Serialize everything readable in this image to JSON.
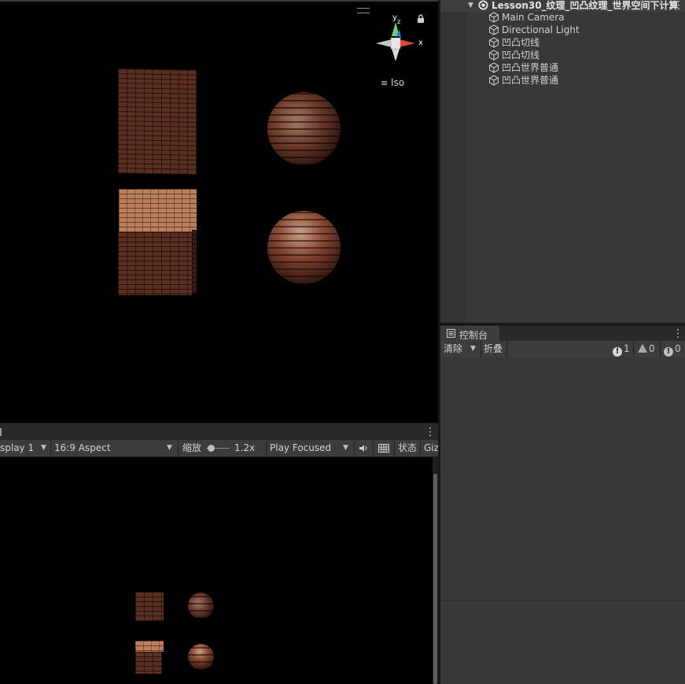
{
  "scene": {
    "iso_label": "Iso",
    "gizmo": {
      "y_label": "y",
      "z_label": "z",
      "x_label": "x"
    }
  },
  "game_view": {
    "tab_label": "",
    "display": "splay 1",
    "aspect": "16:9 Aspect",
    "scale_label": "缩放",
    "scale_value": "1.2x",
    "play_mode": "Play Focused",
    "stats_label": "状态",
    "gizmos_label": "Giz"
  },
  "hierarchy": {
    "scene_name": "Lesson30_纹理_凹凸纹理_世界空间下计算",
    "items": [
      {
        "label": "Main Camera"
      },
      {
        "label": "Directional Light"
      },
      {
        "label": "凹凸切线"
      },
      {
        "label": "凹凸切线"
      },
      {
        "label": "凹凸世界普通"
      },
      {
        "label": "凹凸世界普通"
      }
    ]
  },
  "console": {
    "tab_label": "控制台",
    "clear_label": "清除",
    "collapse_label": "折叠",
    "log_count": "1",
    "warning_count": "0",
    "error_count": "0"
  },
  "colors": {
    "panel_bg": "#383838",
    "toolbar_bg": "#3c3c3c",
    "viewport_bg": "#000000",
    "gizmo_y": "#6ad26a",
    "gizmo_x": "#e0453a",
    "gizmo_z": "#3a6fe0"
  }
}
